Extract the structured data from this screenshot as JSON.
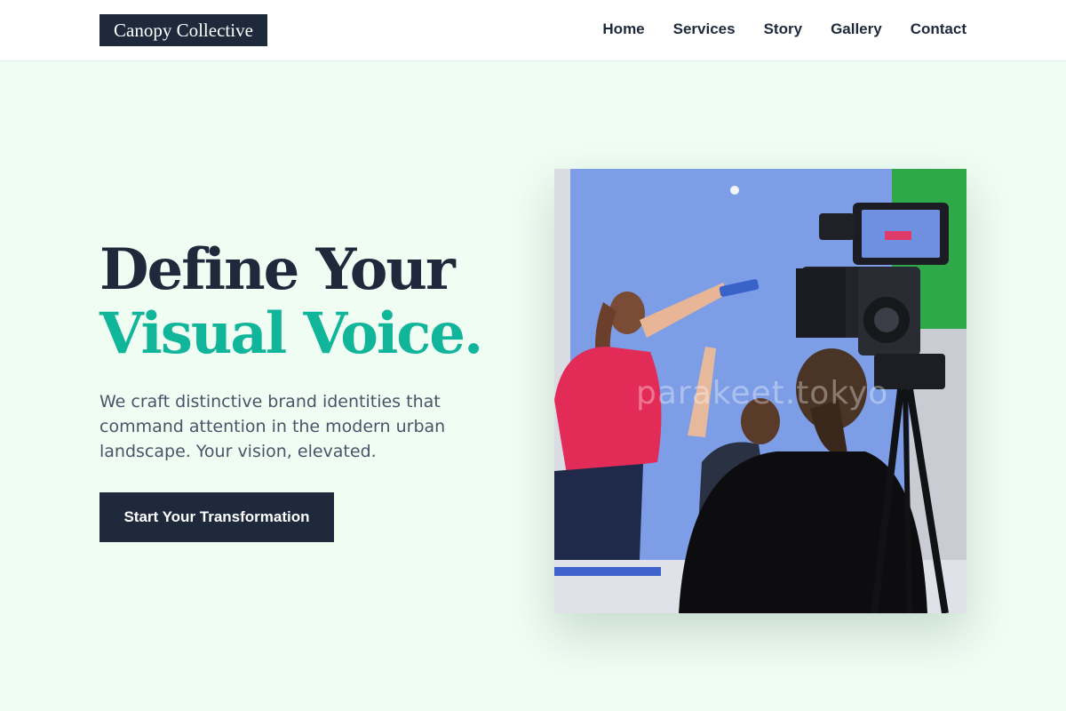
{
  "brand": {
    "name": "Canopy Collective"
  },
  "nav": {
    "items": [
      {
        "label": "Home"
      },
      {
        "label": "Services"
      },
      {
        "label": "Story"
      },
      {
        "label": "Gallery"
      },
      {
        "label": "Contact"
      }
    ]
  },
  "hero": {
    "title_line1": "Define Your",
    "title_line2": "Visual Voice.",
    "subtitle": "We craft distinctive brand identities that command attention in the modern urban landscape. Your vision, elevated.",
    "cta_label": "Start Your Transformation",
    "image_watermark": "parakeet.tokyo"
  },
  "colors": {
    "background": "#effdf3",
    "dark": "#1e293b",
    "accent": "#10b59a",
    "muted_text": "#475569"
  }
}
